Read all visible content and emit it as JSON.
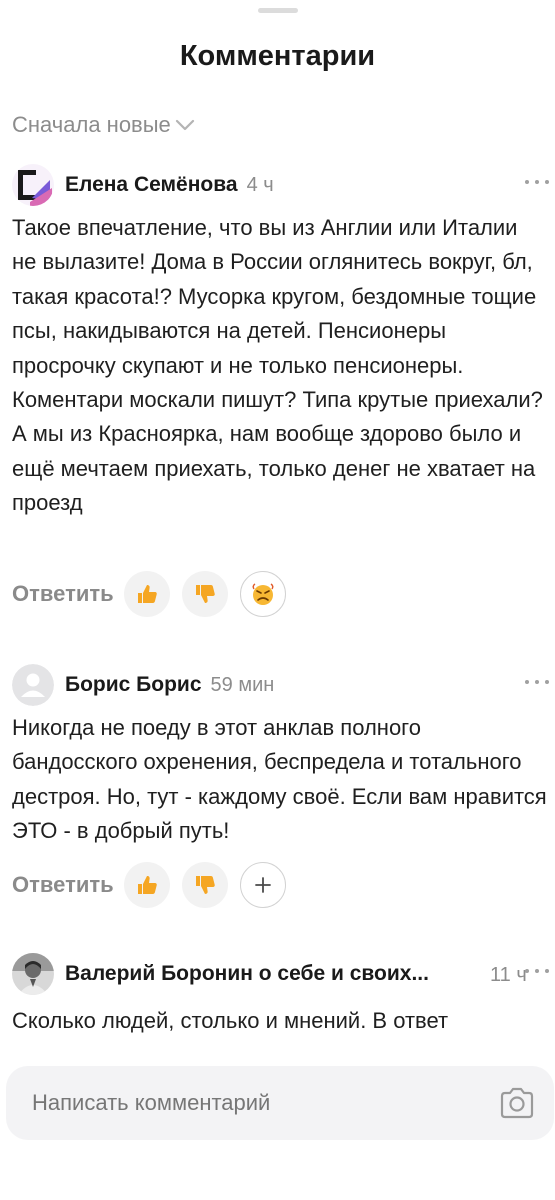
{
  "header": {
    "title": "Комментарии"
  },
  "sort": {
    "label": "Сначала новые"
  },
  "comments": [
    {
      "author": "Елена Семёнова",
      "time": "4 ч",
      "text": "Такое впечатление, что вы из Англии или Италии не вылазите! Дома в России оглянитесь вокруг, бл, такая красота!? Мусорка кругом, бездомные тощие псы, накидываются на детей. Пенсионеры просрочку скупают и не только пенсионеры. Коментари москали пишут? Типа крутые приехали? А мы из Красноярка, нам вообще здорово было и ещё мечтаем приехать, только денег не хватает на проезд",
      "reply_label": "Ответить",
      "reactions": [
        "thumbs-up",
        "thumbs-down",
        "angry-face"
      ]
    },
    {
      "author": "Борис Борис",
      "time": "59 мин",
      "text": "Никогда не поеду в этот анклав полного бандосского охренения, беспредела и тотального дестроя. Но, тут - каждому своё. Если вам нравится ЭТО - в добрый путь!",
      "reply_label": "Ответить",
      "reactions": [
        "thumbs-up",
        "thumbs-down",
        "add-reaction"
      ]
    },
    {
      "author": "Валерий Боронин о себе и своих...",
      "time": "11 ч",
      "text": "Сколько людей, столько и мнений. В ответ",
      "reply_label": "",
      "reactions": []
    }
  ],
  "composer": {
    "placeholder": "Написать комментарий"
  },
  "colors": {
    "muted": "#8c8c8c",
    "bubble": "#f2f2f2",
    "composer": "#f3f3f5",
    "thumb": "#f5a623"
  }
}
